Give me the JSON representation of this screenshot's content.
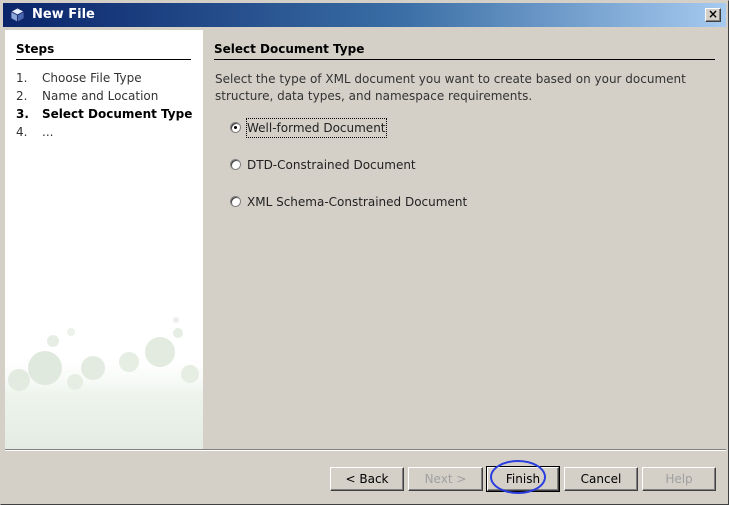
{
  "window": {
    "title": "New File",
    "close_label": "×"
  },
  "steps": {
    "title": "Steps",
    "items": [
      {
        "num": "1.",
        "label": "Choose File Type",
        "current": false
      },
      {
        "num": "2.",
        "label": "Name and Location",
        "current": false
      },
      {
        "num": "3.",
        "label": "Select Document Type",
        "current": true
      },
      {
        "num": "4.",
        "label": "...",
        "current": false
      }
    ]
  },
  "main": {
    "title": "Select Document Type",
    "description_line1": "Select the type of XML document you want to create based on your document",
    "description_line2": "structure, data types, and namespace requirements.",
    "options": [
      {
        "label": "Well-formed Document",
        "selected": true
      },
      {
        "label": "DTD-Constrained Document",
        "selected": false
      },
      {
        "label": "XML Schema-Constrained Document",
        "selected": false
      }
    ]
  },
  "buttons": {
    "back": "< Back",
    "next": "Next >",
    "finish": "Finish",
    "cancel": "Cancel",
    "help": "Help"
  },
  "icons": {
    "title": "cube-icon",
    "close": "close-icon"
  },
  "colors": {
    "titlebar_start": "#0a246a",
    "titlebar_end": "#a6caf0",
    "panel_bg": "#d4d0c8",
    "highlight_ring": "#2a3ee0"
  }
}
